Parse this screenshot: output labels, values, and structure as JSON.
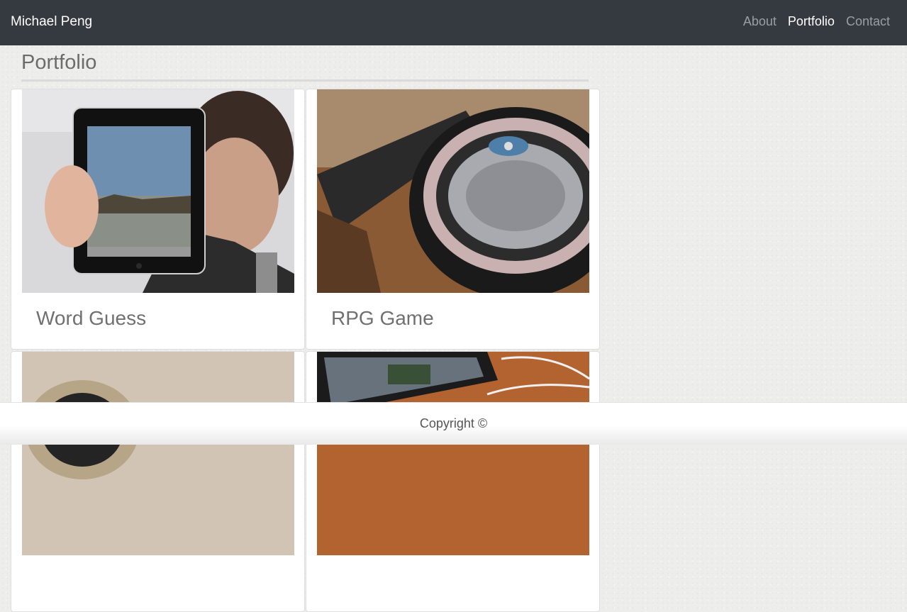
{
  "navbar": {
    "brand": "Michael Peng",
    "links": [
      {
        "label": "About",
        "active": false
      },
      {
        "label": "Portfolio",
        "active": true
      },
      {
        "label": "Contact",
        "active": false
      }
    ]
  },
  "page": {
    "title": "Portfolio"
  },
  "projects": [
    {
      "title": "Word Guess",
      "image": "tablet-photo"
    },
    {
      "title": "RPG Game",
      "image": "turntable-photo"
    },
    {
      "title": "",
      "image": "speaker-photo"
    },
    {
      "title": "",
      "image": "phone-photo"
    }
  ],
  "footer": {
    "text": "Copyright ©"
  }
}
